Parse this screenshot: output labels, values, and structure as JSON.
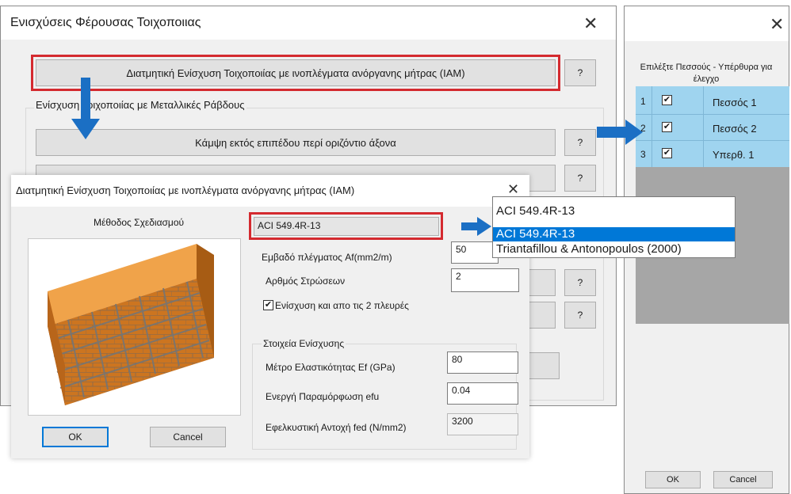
{
  "main_dialog": {
    "title": "Ενισχύσεις Φέρουσας Τοιχοποιιας",
    "iam_button": "Διατμητική Ενίσχυση Τοιχοποιίας με ινοπλέγματα ανόργανης μήτρας (IAM)",
    "help": "?",
    "group_label": "Ενίσχυση Τοιχοποιίας με Μεταλλικές Ράβδους",
    "bending_button": "Κάμψη εκτός επιπέδου περί οριζόντιο άξονα"
  },
  "iam_dialog": {
    "title": "Διατμητική Ενίσχυση Τοιχοποιίας με ινοπλέγματα ανόργανης μήτρας (IAM)",
    "method_label": "Μέθοδος Σχεδιασμού",
    "method_value": "ACI 549.4R-13",
    "mesh_area_label": "Εμβαδό πλέγματος Af(mm2/m)",
    "mesh_area_value": "50",
    "layers_label": "Αρθμός Στρώσεων",
    "layers_value": "2",
    "both_sides_label": "Ενίσχυση και απο τις 2 πλευρές",
    "both_sides_checked": true,
    "reinf_data_label": "Στοιχεία Ενίσχυσης",
    "modulus_label": "Μέτρο Ελαστικότητας Ef (GPa)",
    "modulus_value": "80",
    "strain_label": "Ενεργή Παραμόρφωση efu",
    "strain_value": "0.04",
    "stress_label": "Εφελκυστική Αντοχή fed (N/mm2)",
    "stress_value": "3200",
    "ok": "OK",
    "cancel": "Cancel"
  },
  "method_dropdown": {
    "selected": "ACI 549.4R-13",
    "options": [
      "ACI 549.4R-13",
      "Triantafillou & Antonopoulos (2000)"
    ]
  },
  "pier_dialog": {
    "header": "Επιλέξτε Πεσσούς - Υπέρθυρα για έλεγχο",
    "rows": [
      {
        "num": "1",
        "checked": true,
        "name": "Πεσσός 1"
      },
      {
        "num": "2",
        "checked": true,
        "name": "Πεσσός 2"
      },
      {
        "num": "3",
        "checked": true,
        "name": "Υπερθ. 1"
      }
    ],
    "ok": "OK",
    "cancel": "Cancel"
  },
  "colors": {
    "accent_blue": "#1b6fc4",
    "highlight_red": "#d42a2f",
    "selection_blue": "#0078d7",
    "grid_blue": "#9fd4ef"
  },
  "icons": {
    "close": "close-icon",
    "arrow": "arrow-icon",
    "check": "check-icon",
    "wall": "masonry-wall-image"
  }
}
